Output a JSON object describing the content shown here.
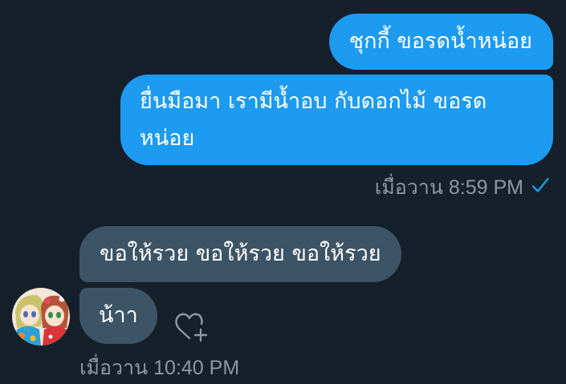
{
  "conversation": {
    "sent_messages": [
      "ชุกกี้ ขอรดน้ำหน่อย",
      "ยื่นมือมา เรามีน้ำอบ กับดอกไม้ ขอรดหน่อย"
    ],
    "sent_timestamp": "เมื่อวาน 8:59 PM",
    "received_messages": [
      "ขอให้รวย ขอให้รวย ขอให้รวย",
      "น้าา"
    ],
    "received_timestamp": "เมื่อวาน 10:40 PM"
  },
  "icons": {
    "read_receipt": "checkmark-icon",
    "reaction": "heart-plus-icon",
    "avatar": "anime-duo-avatar"
  },
  "colors": {
    "background": "#15202b",
    "sent_bubble": "#1d9bf0",
    "received_bubble": "#3d5466",
    "timestamp": "#8b98a5",
    "check": "#1d9bf0",
    "reaction_icon": "#8b98a5"
  }
}
